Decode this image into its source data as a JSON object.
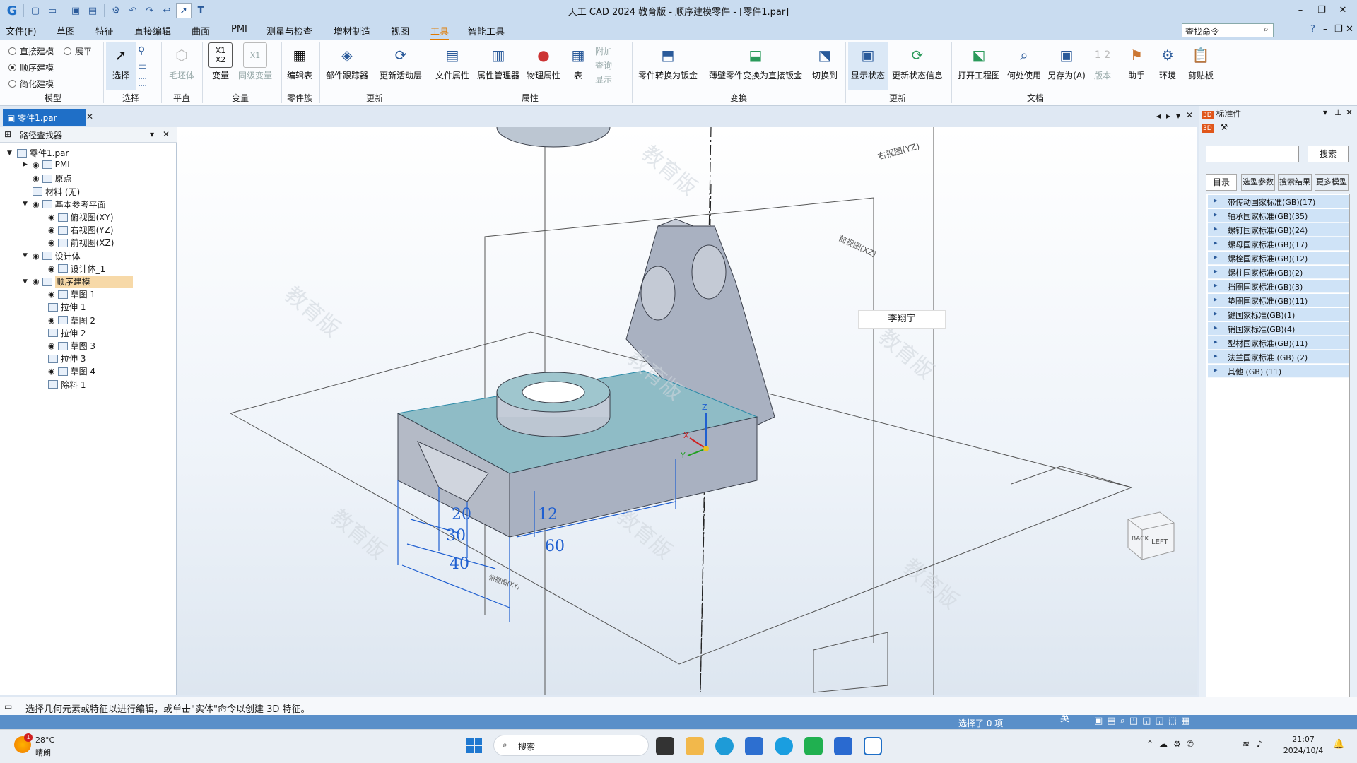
{
  "window": {
    "title": "天工 CAD 2024 教育版 - 顺序建模零件 - [零件1.par]",
    "controls": [
      "–",
      "❐",
      "✕"
    ]
  },
  "menu": {
    "items": [
      "文件(F)",
      "草图",
      "特征",
      "直接编辑",
      "曲面",
      "PMI",
      "测量与检查",
      "增材制造",
      "视图",
      "工具",
      "智能工具"
    ],
    "active": "工具",
    "find_placeholder": "查找命令"
  },
  "ribbon": {
    "model_options": [
      "直接建模",
      "顺序建模",
      "简化建模"
    ],
    "unfold": "展平",
    "groups": {
      "model": "模型",
      "select": "选择",
      "plane": "平直",
      "variables": "变量",
      "family": "零件族",
      "update": "更新",
      "props": "属性",
      "convert": "变换",
      "update2": "更新",
      "docs": "文档"
    },
    "buttons": {
      "select": "选择",
      "rough": "毛坯体",
      "variables": "变量",
      "peer_vars": "同级变量",
      "edit_table": "编辑表",
      "part_tracker": "部件跟踪器",
      "update_active": "更新活动层",
      "file_props": "文件属性",
      "prop_manager": "属性管理器",
      "phys_props": "物理属性",
      "table": "表",
      "attach": "附加",
      "query": "查询",
      "show": "显示",
      "to_sheetmetal": "零件转换为钣金",
      "thin_to_sheetmetal": "薄壁零件变换为直接钣金",
      "switch_to": "切换到",
      "display_state": "显示状态",
      "update_state": "更新状态信息",
      "open_drawing": "打开工程图",
      "where_used": "何处使用",
      "save_as": "另存为(A)",
      "version": "版本",
      "assistant": "助手",
      "environment": "环境",
      "clipboard": "剪贴板"
    }
  },
  "doc_tab": "零件1.par",
  "pathfinder": {
    "title": "路径查找器",
    "items": [
      {
        "label": "零件1.par",
        "level": 0
      },
      {
        "label": "PMI",
        "level": 1
      },
      {
        "label": "原点",
        "level": 1
      },
      {
        "label": "材料 (无)",
        "level": 1
      },
      {
        "label": "基本参考平面",
        "level": 1
      },
      {
        "label": "俯视图(XY)",
        "level": 2
      },
      {
        "label": "右视图(YZ)",
        "level": 2
      },
      {
        "label": "前视图(XZ)",
        "level": 2
      },
      {
        "label": "设计体",
        "level": 1
      },
      {
        "label": "设计体_1",
        "level": 2
      },
      {
        "label": "顺序建模",
        "level": 1
      },
      {
        "label": "草图 1",
        "level": 2
      },
      {
        "label": "拉伸 1",
        "level": 2
      },
      {
        "label": "草图 2",
        "level": 2
      },
      {
        "label": "拉伸 2",
        "level": 2
      },
      {
        "label": "草图 3",
        "level": 2
      },
      {
        "label": "拉伸 3",
        "level": 2
      },
      {
        "label": "草图 4",
        "level": 2
      },
      {
        "label": "除料 1",
        "level": 2
      }
    ]
  },
  "viewport": {
    "plane_labels": {
      "right": "右视图(YZ)",
      "front": "前视图(XZ)",
      "top": "俯视图(XY)"
    },
    "watermark": "教育版",
    "dims": [
      "20",
      "30",
      "40",
      "12",
      "60"
    ],
    "user_tag": "李翔宇",
    "cube": {
      "back": "BACK",
      "left": "LEFT"
    },
    "axis": {
      "z": "Z",
      "x": "X",
      "y": "Y"
    }
  },
  "std_parts": {
    "title": "标准件",
    "search_btn": "搜索",
    "tabs": [
      "目录",
      "选型参数",
      "搜索结果",
      "更多模型"
    ],
    "categories": [
      "带传动国家标准(GB)(17)",
      "轴承国家标准(GB)(35)",
      "螺钉国家标准(GB)(24)",
      "螺母国家标准(GB)(17)",
      "螺栓国家标准(GB)(12)",
      "螺柱国家标准(GB)(2)",
      "挡圈国家标准(GB)(3)",
      "垫圈国家标准(GB)(11)",
      "键国家标准(GB)(1)",
      "销国家标准(GB)(4)",
      "型材国家标准(GB)(11)",
      "法兰国家标准 (GB) (2)",
      "其他 (GB) (11)"
    ]
  },
  "status": {
    "prompt": "选择几何元素或特征以进行编辑，或单击\"实体\"命令以创建 3D 特征。",
    "selected": "选择了 0 项"
  },
  "taskbar": {
    "weather_temp": "28°C",
    "weather_desc": "晴朗",
    "badge": "1",
    "search": "搜索",
    "ime": "英",
    "time": "21:07",
    "date": "2024/10/4"
  },
  "colors": {
    "accent": "#1f6fc7",
    "ribbon_active": "#e07a00",
    "dim_blue": "#1f5fd0",
    "part_gray": "#a9b1c1",
    "part_top": "#8fbcc6"
  }
}
